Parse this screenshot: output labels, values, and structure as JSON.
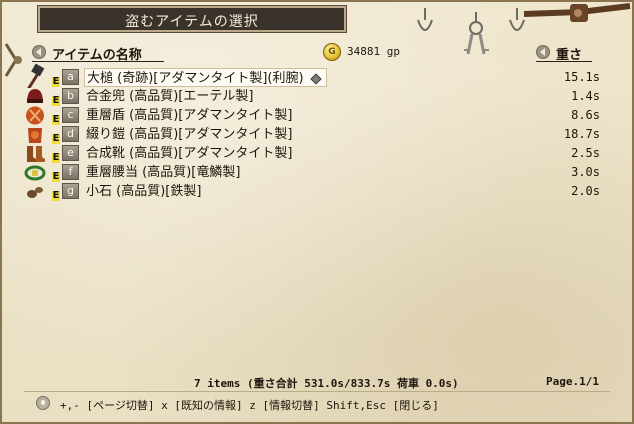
{
  "window": {
    "title": "盗むアイテムの選択"
  },
  "header": {
    "name_col": "アイテムの名称",
    "weight_col": "重さ",
    "gold": "34881 gp"
  },
  "items": [
    {
      "letter": "a",
      "equip": "E",
      "name": "大槌 (奇跡)[アダマンタイト製](利腕)",
      "weight": "15.1s",
      "icon": "hammer-icon"
    },
    {
      "letter": "b",
      "equip": "E",
      "name": "合金兜 (高品質)[エーテル製]",
      "weight": "1.4s",
      "icon": "helmet-icon"
    },
    {
      "letter": "c",
      "equip": "E",
      "name": "重層盾 (高品質)[アダマンタイト製]",
      "weight": "8.6s",
      "icon": "shield-icon"
    },
    {
      "letter": "d",
      "equip": "E",
      "name": "綴り鎧 (高品質)[アダマンタイト製]",
      "weight": "18.7s",
      "icon": "armor-icon"
    },
    {
      "letter": "e",
      "equip": "E",
      "name": "合成靴 (高品質)[アダマンタイト製]",
      "weight": "2.5s",
      "icon": "boots-icon"
    },
    {
      "letter": "f",
      "equip": "E",
      "name": "重層腰当 (高品質)[竜鱗製]",
      "weight": "3.0s",
      "icon": "belt-icon"
    },
    {
      "letter": "g",
      "equip": "E",
      "name": "小石 (高品質)[鉄製]",
      "weight": "2.0s",
      "icon": "stone-icon"
    }
  ],
  "footer": {
    "stats": "7 items  (重さ合計 531.0s/833.7s  荷車 0.0s)",
    "page": "Page.1/1",
    "help": "+,- [ページ切替]  x [既知の情報]  z [情報切替]  Shift,Esc [閉じる]"
  },
  "colors": {
    "title_bg": "#3a332c",
    "parchment": "#ede3c9",
    "equip_badge": "#f1dc3a"
  }
}
